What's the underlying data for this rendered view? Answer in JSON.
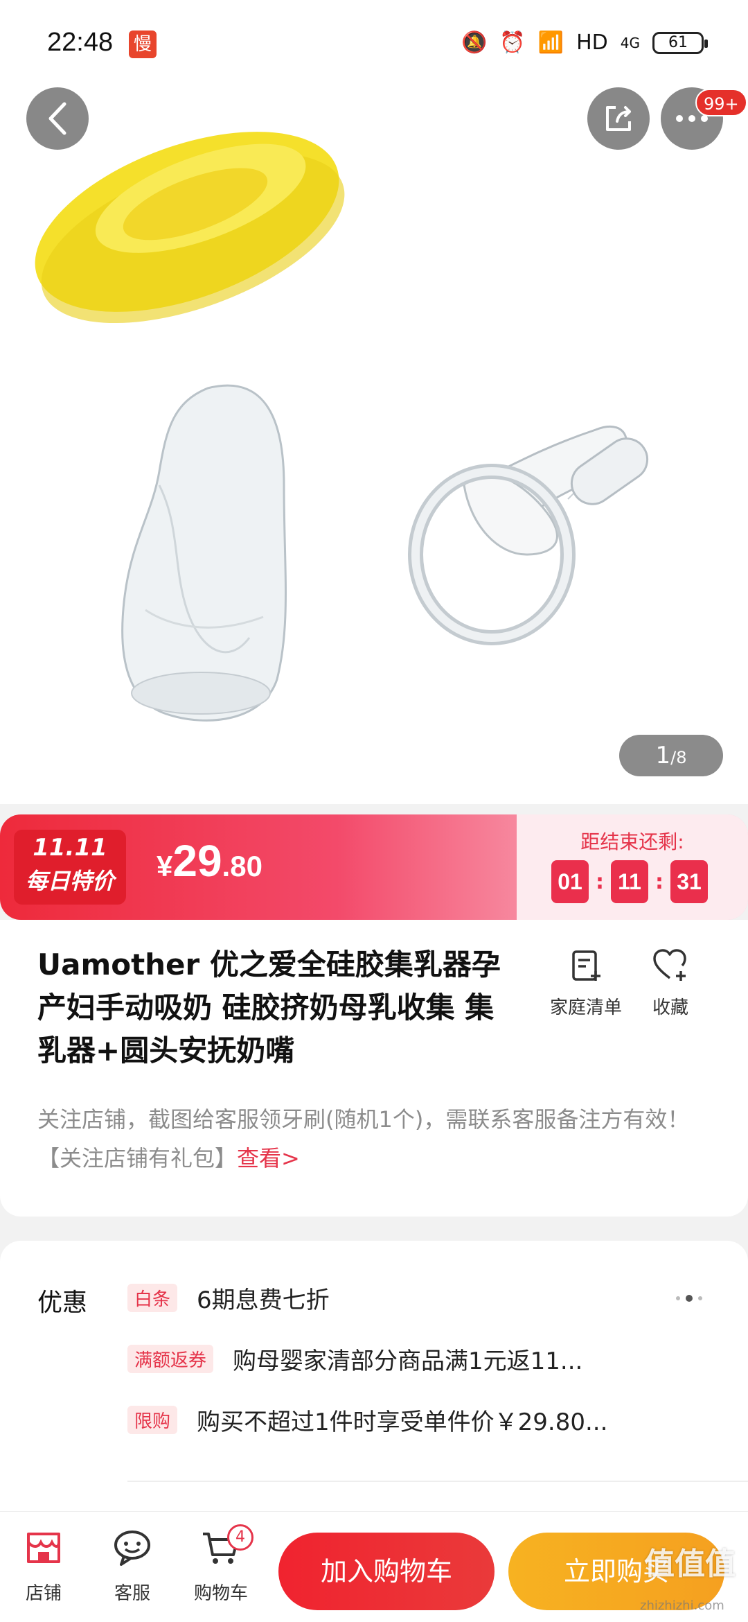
{
  "status_bar": {
    "time": "22:48",
    "app_badge": "慢",
    "network": "HD",
    "signal": "4G",
    "battery": "61"
  },
  "hero": {
    "page_current": "1",
    "page_total": "/8",
    "more_badge": "99+"
  },
  "price_banner": {
    "promo_line1": "11.11",
    "promo_line2": "每日特价",
    "currency": "¥",
    "price_int": "29",
    "price_dec": ".80",
    "countdown_label": "距结束还剩:",
    "countdown": [
      "01",
      "11",
      "31"
    ]
  },
  "product": {
    "title": "Uamother 优之爱全硅胶集乳器孕产妇手动吸奶 硅胶挤奶母乳收集 集乳器+圆头安抚奶嘴",
    "family_list_label": "家庭清单",
    "favorite_label": "收藏",
    "promo_text": "关注店铺，截图给客服领牙刷(随机1个)，需联系客服备注方有效！【关注店铺有礼包】",
    "promo_link": "查看>"
  },
  "offers": {
    "label": "优惠",
    "rows": [
      {
        "tag": "白条",
        "text": "6期息费七折"
      },
      {
        "tag": "满额返券",
        "text": "购母婴家清部分商品满1元返11..."
      },
      {
        "tag": "限购",
        "text": "购买不超过1件时享受单件价￥29.80..."
      }
    ]
  },
  "bottom_bar": {
    "store_label": "店铺",
    "service_label": "客服",
    "cart_label": "购物车",
    "cart_count": "4",
    "add_to_cart_label": "加入购物车",
    "buy_now_label": "立即购买"
  },
  "watermark": {
    "text": "值值值",
    "sub": "zhizhizhi.com"
  },
  "colors": {
    "accent_red": "#e5344a",
    "buy_orange": "#f7b221",
    "pump_yellow": "#f5e02b"
  }
}
